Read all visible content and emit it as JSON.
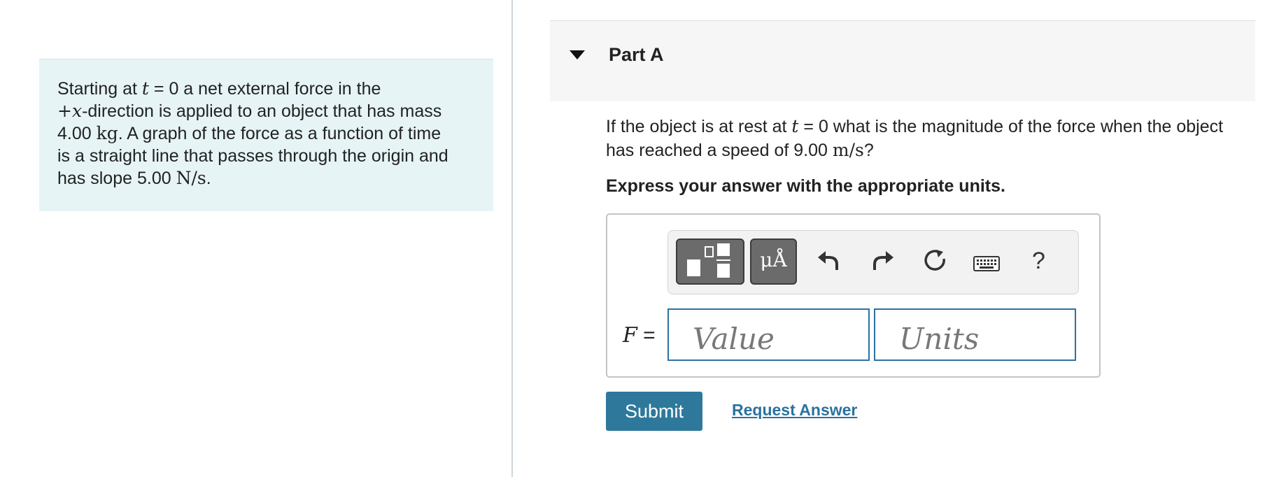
{
  "problem": {
    "line1_a": "Starting at ",
    "line1_t": "t",
    "line1_b": " = 0 a net external force in the",
    "line2_sign": "+",
    "line2_x": "x",
    "line2_b": "-direction is applied to an object that has mass",
    "line3_num": "4.00 ",
    "line3_unit": "kg",
    "line3_b": ". A graph of the force as a function of time",
    "line4": "is a straight line that passes through the origin and",
    "line5_a": "has slope 5.00 ",
    "line5_unit": "N/s",
    "line5_b": "."
  },
  "part": {
    "title": "Part A",
    "question_a": "If the object is at rest at ",
    "question_t": "t",
    "question_b": " = 0 what is the magnitude of the force when the object",
    "question_c": "has reached a speed of 9.00 ",
    "question_unit": "m/s",
    "question_d": "?",
    "instruction": "Express your answer with the appropriate units."
  },
  "toolbar": {
    "units_glyph": "μÅ",
    "help_label": "?",
    "icons": [
      "templates-icon",
      "units-icon",
      "undo-icon",
      "redo-icon",
      "reset-icon",
      "keyboard-icon",
      "help-icon"
    ]
  },
  "answer": {
    "variable": "F",
    "equals": " =",
    "value_placeholder": "Value",
    "units_placeholder": "Units"
  },
  "actions": {
    "submit_label": "Submit",
    "request_label": "Request Answer"
  },
  "colors": {
    "problem_bg": "#e6f4f6",
    "accent": "#2e799b",
    "link": "#2a72a0"
  }
}
